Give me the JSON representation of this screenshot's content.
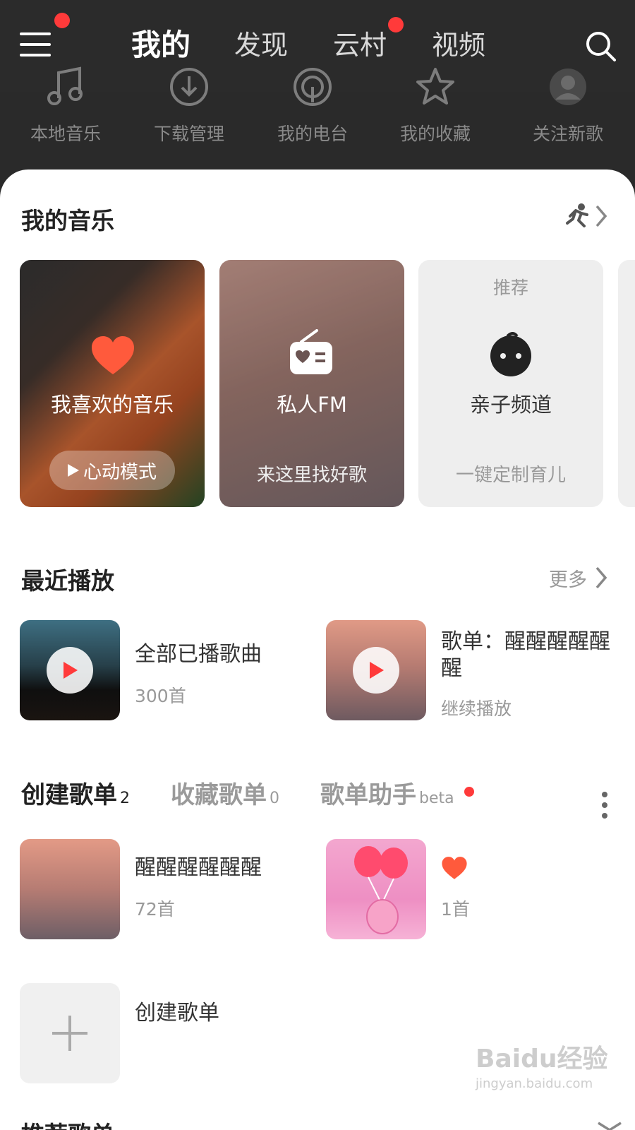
{
  "header": {
    "tabs": [
      {
        "label": "我的",
        "active": true
      },
      {
        "label": "发现",
        "active": false
      },
      {
        "label": "云村",
        "active": false,
        "badge": true
      },
      {
        "label": "视频",
        "active": false
      }
    ]
  },
  "shortcuts": [
    {
      "label": "本地音乐",
      "icon": "music-note-icon"
    },
    {
      "label": "下载管理",
      "icon": "download-icon"
    },
    {
      "label": "我的电台",
      "icon": "radio-podcast-icon"
    },
    {
      "label": "我的收藏",
      "icon": "star-icon"
    },
    {
      "label": "关注新歌",
      "icon": "avatar-icon"
    }
  ],
  "my_music": {
    "title": "我的音乐",
    "cards": [
      {
        "title": "我喜欢的音乐",
        "button": "心动模式"
      },
      {
        "title": "私人FM",
        "subtitle": "来这里找好歌"
      },
      {
        "tag": "推荐",
        "title": "亲子频道",
        "subtitle": "一键定制育儿"
      }
    ]
  },
  "recent": {
    "title": "最近播放",
    "more_label": "更多",
    "items": [
      {
        "title": "全部已播歌曲",
        "sub": "300首"
      },
      {
        "title": "歌单：醒醒醒醒醒醒",
        "sub": "继续播放"
      }
    ]
  },
  "playlists": {
    "tabs": [
      {
        "label": "创建歌单",
        "count": "2"
      },
      {
        "label": "收藏歌单",
        "count": "0"
      },
      {
        "label": "歌单助手",
        "count": "beta"
      }
    ],
    "items": [
      {
        "title": "醒醒醒醒醒醒",
        "sub": "72首"
      },
      {
        "title": "",
        "sub": "1首"
      }
    ],
    "create_label": "创建歌单"
  },
  "recommend": {
    "title": "推荐歌单"
  },
  "watermark": {
    "brand": "Baidu经验",
    "url": "jingyan.baidu.com"
  },
  "colors": {
    "accent": "#ff3a3a",
    "heart": "#ff5a3c",
    "header_bg": "#2b2b2b"
  }
}
